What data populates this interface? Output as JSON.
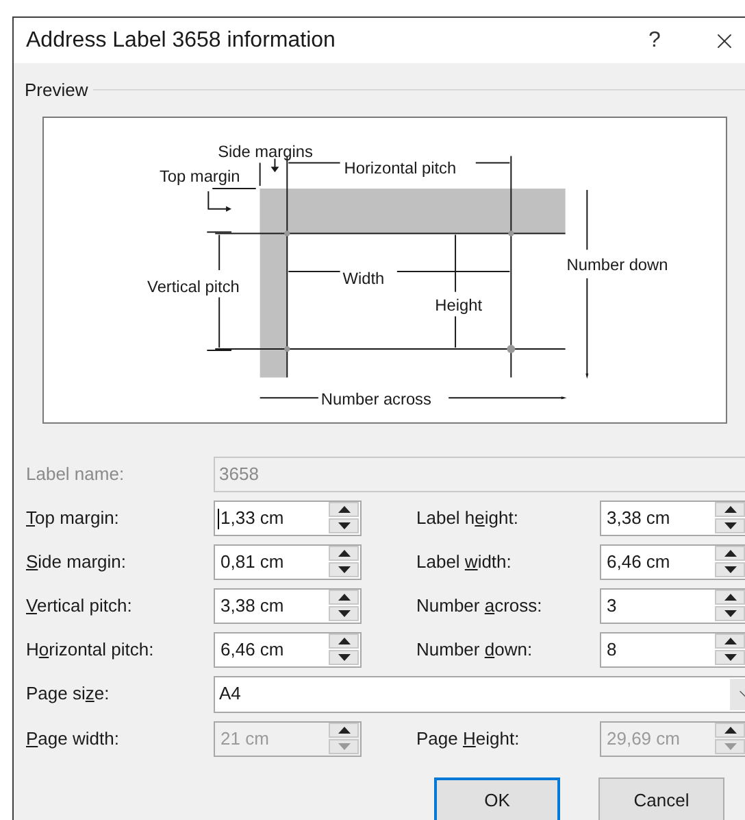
{
  "window": {
    "title": "Address Label 3658 information",
    "help": "?"
  },
  "preview": {
    "heading": "Preview",
    "labels": [
      "Side margins",
      "Top margin",
      "Horizontal pitch",
      "Vertical pitch",
      "Width",
      "Height",
      "Number down",
      "Number across"
    ]
  },
  "rows": [
    {
      "kind": "text",
      "label": {
        "pre": "Label name:"
      },
      "value": "3658",
      "disabled": true
    },
    {
      "kind": "pair",
      "left": {
        "label": {
          "key": "T",
          "post": "op margin:"
        },
        "value": "1,33 cm",
        "disabled": false,
        "focused": true
      },
      "right": {
        "label": {
          "pre": "Label h",
          "key": "e",
          "post": "ight:"
        },
        "value": "3,38 cm",
        "disabled": false,
        "focused": false
      }
    },
    {
      "kind": "pair",
      "left": {
        "label": {
          "key": "S",
          "post": "ide margin:"
        },
        "value": "0,81 cm",
        "disabled": false,
        "focused": false
      },
      "right": {
        "label": {
          "pre": "Label ",
          "key": "w",
          "post": "idth:"
        },
        "value": "6,46 cm",
        "disabled": false,
        "focused": false
      }
    },
    {
      "kind": "pair",
      "left": {
        "label": {
          "key": "V",
          "post": "ertical pitch:"
        },
        "value": "3,38 cm",
        "disabled": false,
        "focused": false
      },
      "right": {
        "label": {
          "pre": "Number ",
          "key": "a",
          "post": "cross:"
        },
        "value": "3",
        "disabled": false,
        "focused": false
      }
    },
    {
      "kind": "pair",
      "left": {
        "label": {
          "pre": "H",
          "key": "o",
          "post": "rizontal pitch:"
        },
        "value": "6,46 cm",
        "disabled": false,
        "focused": false
      },
      "right": {
        "label": {
          "pre": "Number ",
          "key": "d",
          "post": "own:"
        },
        "value": "8",
        "disabled": false,
        "focused": false
      }
    },
    {
      "kind": "select",
      "label": {
        "pre": "Page si",
        "key": "z",
        "post": "e:"
      },
      "value": "A4"
    },
    {
      "kind": "pair",
      "left": {
        "label": {
          "key": "P",
          "post": "age width:"
        },
        "value": "21 cm",
        "disabled": true,
        "focused": false
      },
      "right": {
        "label": {
          "pre": "Page ",
          "key": "H",
          "post": "eight:"
        },
        "value": "29,69 cm",
        "disabled": true,
        "focused": false
      }
    }
  ],
  "buttons": [
    {
      "label": "OK",
      "default": true
    },
    {
      "label": "Cancel",
      "default": false
    }
  ]
}
